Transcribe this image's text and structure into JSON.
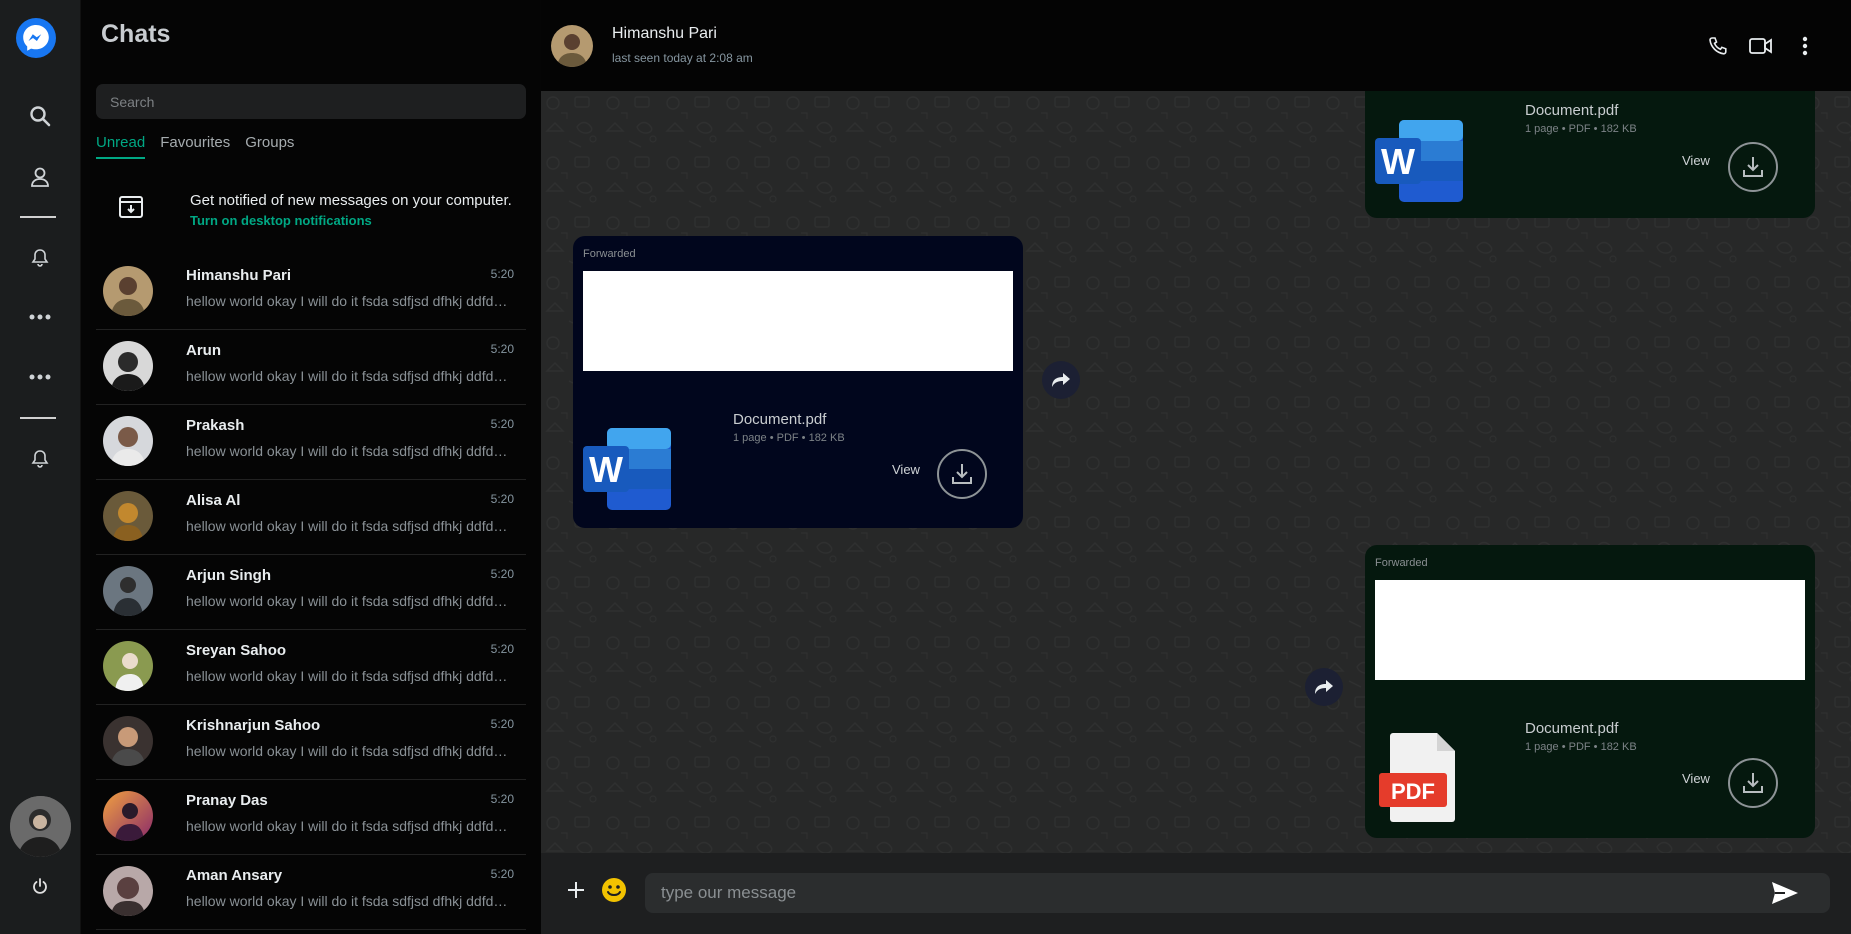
{
  "sidebar": {
    "title": "Chats",
    "search_placeholder": "Search",
    "tabs": [
      {
        "label": "Unread",
        "active": true
      },
      {
        "label": "Favourites",
        "active": false
      },
      {
        "label": "Groups",
        "active": false
      }
    ],
    "notification": {
      "text": "Get notified of new messages on your computer.",
      "link": "Turn on desktop notifications"
    },
    "chats": [
      {
        "name": "Himanshu Pari",
        "time": "5:20",
        "preview": "hellow world okay I will do it fsda sdfjsd dfhkj ddfdsfs",
        "avatar_color": "#9a7a4a"
      },
      {
        "name": "Arun",
        "time": "5:20",
        "preview": "hellow world okay I will do it fsda sdfjsd dfhkj ddfdsfs",
        "avatar_color": "#3a3a3a"
      },
      {
        "name": "Prakash",
        "time": "5:20",
        "preview": "hellow world okay I will do it fsda sdfjsd dfhkj ddfdsfs",
        "avatar_color": "#c8cbd0"
      },
      {
        "name": "Alisa Al",
        "time": "5:20",
        "preview": "hellow world okay I will do it fsda sdfjsd dfhkj ddfdsfs",
        "avatar_color": "#8a6a30"
      },
      {
        "name": "Arjun Singh",
        "time": "5:20",
        "preview": "hellow world okay I will do it fsda sdfjsd dfhkj ddfdsfs",
        "avatar_color": "#4a5560"
      },
      {
        "name": "Sreyan Sahoo",
        "time": "5:20",
        "preview": "hellow world okay I will do it fsda sdfjsd dfhkj ddfdsfs",
        "avatar_color": "#7a8a4a"
      },
      {
        "name": "Krishnarjun Sahoo",
        "time": "5:20",
        "preview": "hellow world okay I will do it fsda sdfjsd dfhkj ddfdsfs",
        "avatar_color": "#6a5040"
      },
      {
        "name": "Pranay Das",
        "time": "5:20",
        "preview": "hellow world okay I will do it fsda sdfjsd dfhkj ddfdsfs",
        "avatar_color": "#b0605a"
      },
      {
        "name": "Aman Ansary",
        "time": "5:20",
        "preview": "hellow world okay I will do it fsda sdfjsd dfhkj ddfdsfs",
        "avatar_color": "#9a8a8a"
      }
    ]
  },
  "header": {
    "name": "Himanshu Pari",
    "status": "last seen today at 2:08 am"
  },
  "messages": [
    {
      "forwarded": "",
      "file_name": "Document.pdf",
      "file_meta": "1 page • PDF • 182 KB",
      "view_label": "View",
      "icon": "word-icon"
    },
    {
      "forwarded": "Forwarded",
      "file_name": "Document.pdf",
      "file_meta": "1 page • PDF • 182 KB",
      "view_label": "View",
      "icon": "word-icon"
    },
    {
      "forwarded": "Forwarded",
      "file_name": "Document.pdf",
      "file_meta": "1 page • PDF • 182 KB",
      "view_label": "View",
      "icon": "pdf-icon",
      "pdf_label": "PDF"
    }
  ],
  "composer": {
    "placeholder": "type our message"
  },
  "colors": {
    "accent": "#00a884",
    "outgoing_bubble": "#05180e",
    "incoming_bubble": "#01061d",
    "messenger_blue": "#1877f2"
  }
}
